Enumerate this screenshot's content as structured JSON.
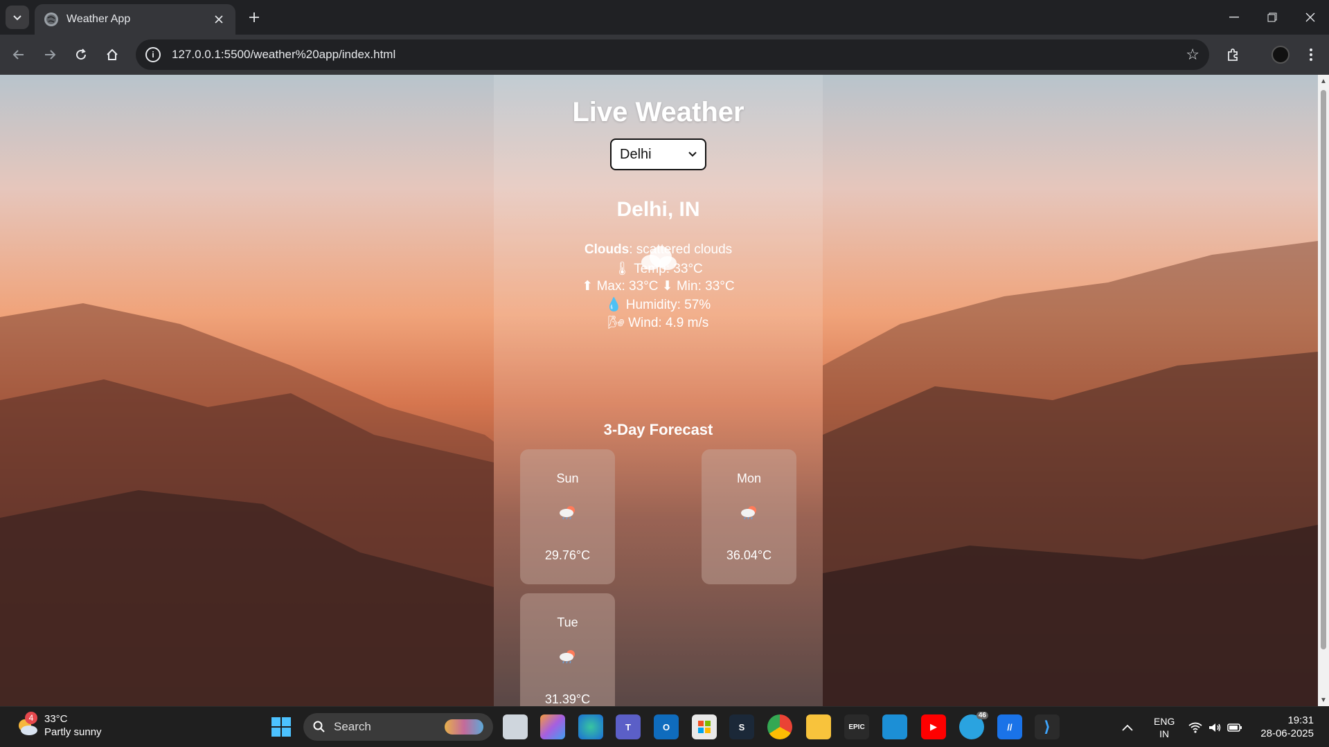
{
  "browser": {
    "tab_title": "Weather App",
    "url": "127.0.0.1:5500/weather%20app/index.html"
  },
  "app": {
    "title": "Live Weather",
    "selected_city": "Delhi",
    "location": "Delhi, IN",
    "condition_main": "Clouds",
    "condition_desc": ": scattered clouds",
    "temp_line": "🌡 Temp: 33°C",
    "maxmin_line": "⬆ Max: 33°C ⬇ Min: 33°C",
    "humidity_line": "💧 Humidity: 57%",
    "wind_line": "🌬 Wind: 4.9 m/s",
    "forecast_title": "3-Day Forecast",
    "forecast": [
      {
        "day": "Sun",
        "temp": "29.76°C",
        "icon": "rain-cloud-icon"
      },
      {
        "day": "Mon",
        "temp": "36.04°C",
        "icon": "rain-cloud-icon"
      },
      {
        "day": "Tue",
        "temp": "31.39°C",
        "icon": "rain-cloud-icon"
      }
    ]
  },
  "taskbar": {
    "weather_temp": "33°C",
    "weather_desc": "Partly sunny",
    "weather_badge": "4",
    "search_label": "Search",
    "lang_top": "ENG",
    "lang_bottom": "IN",
    "time": "19:31",
    "date": "28-06-2025",
    "telegram_badge": "46"
  }
}
